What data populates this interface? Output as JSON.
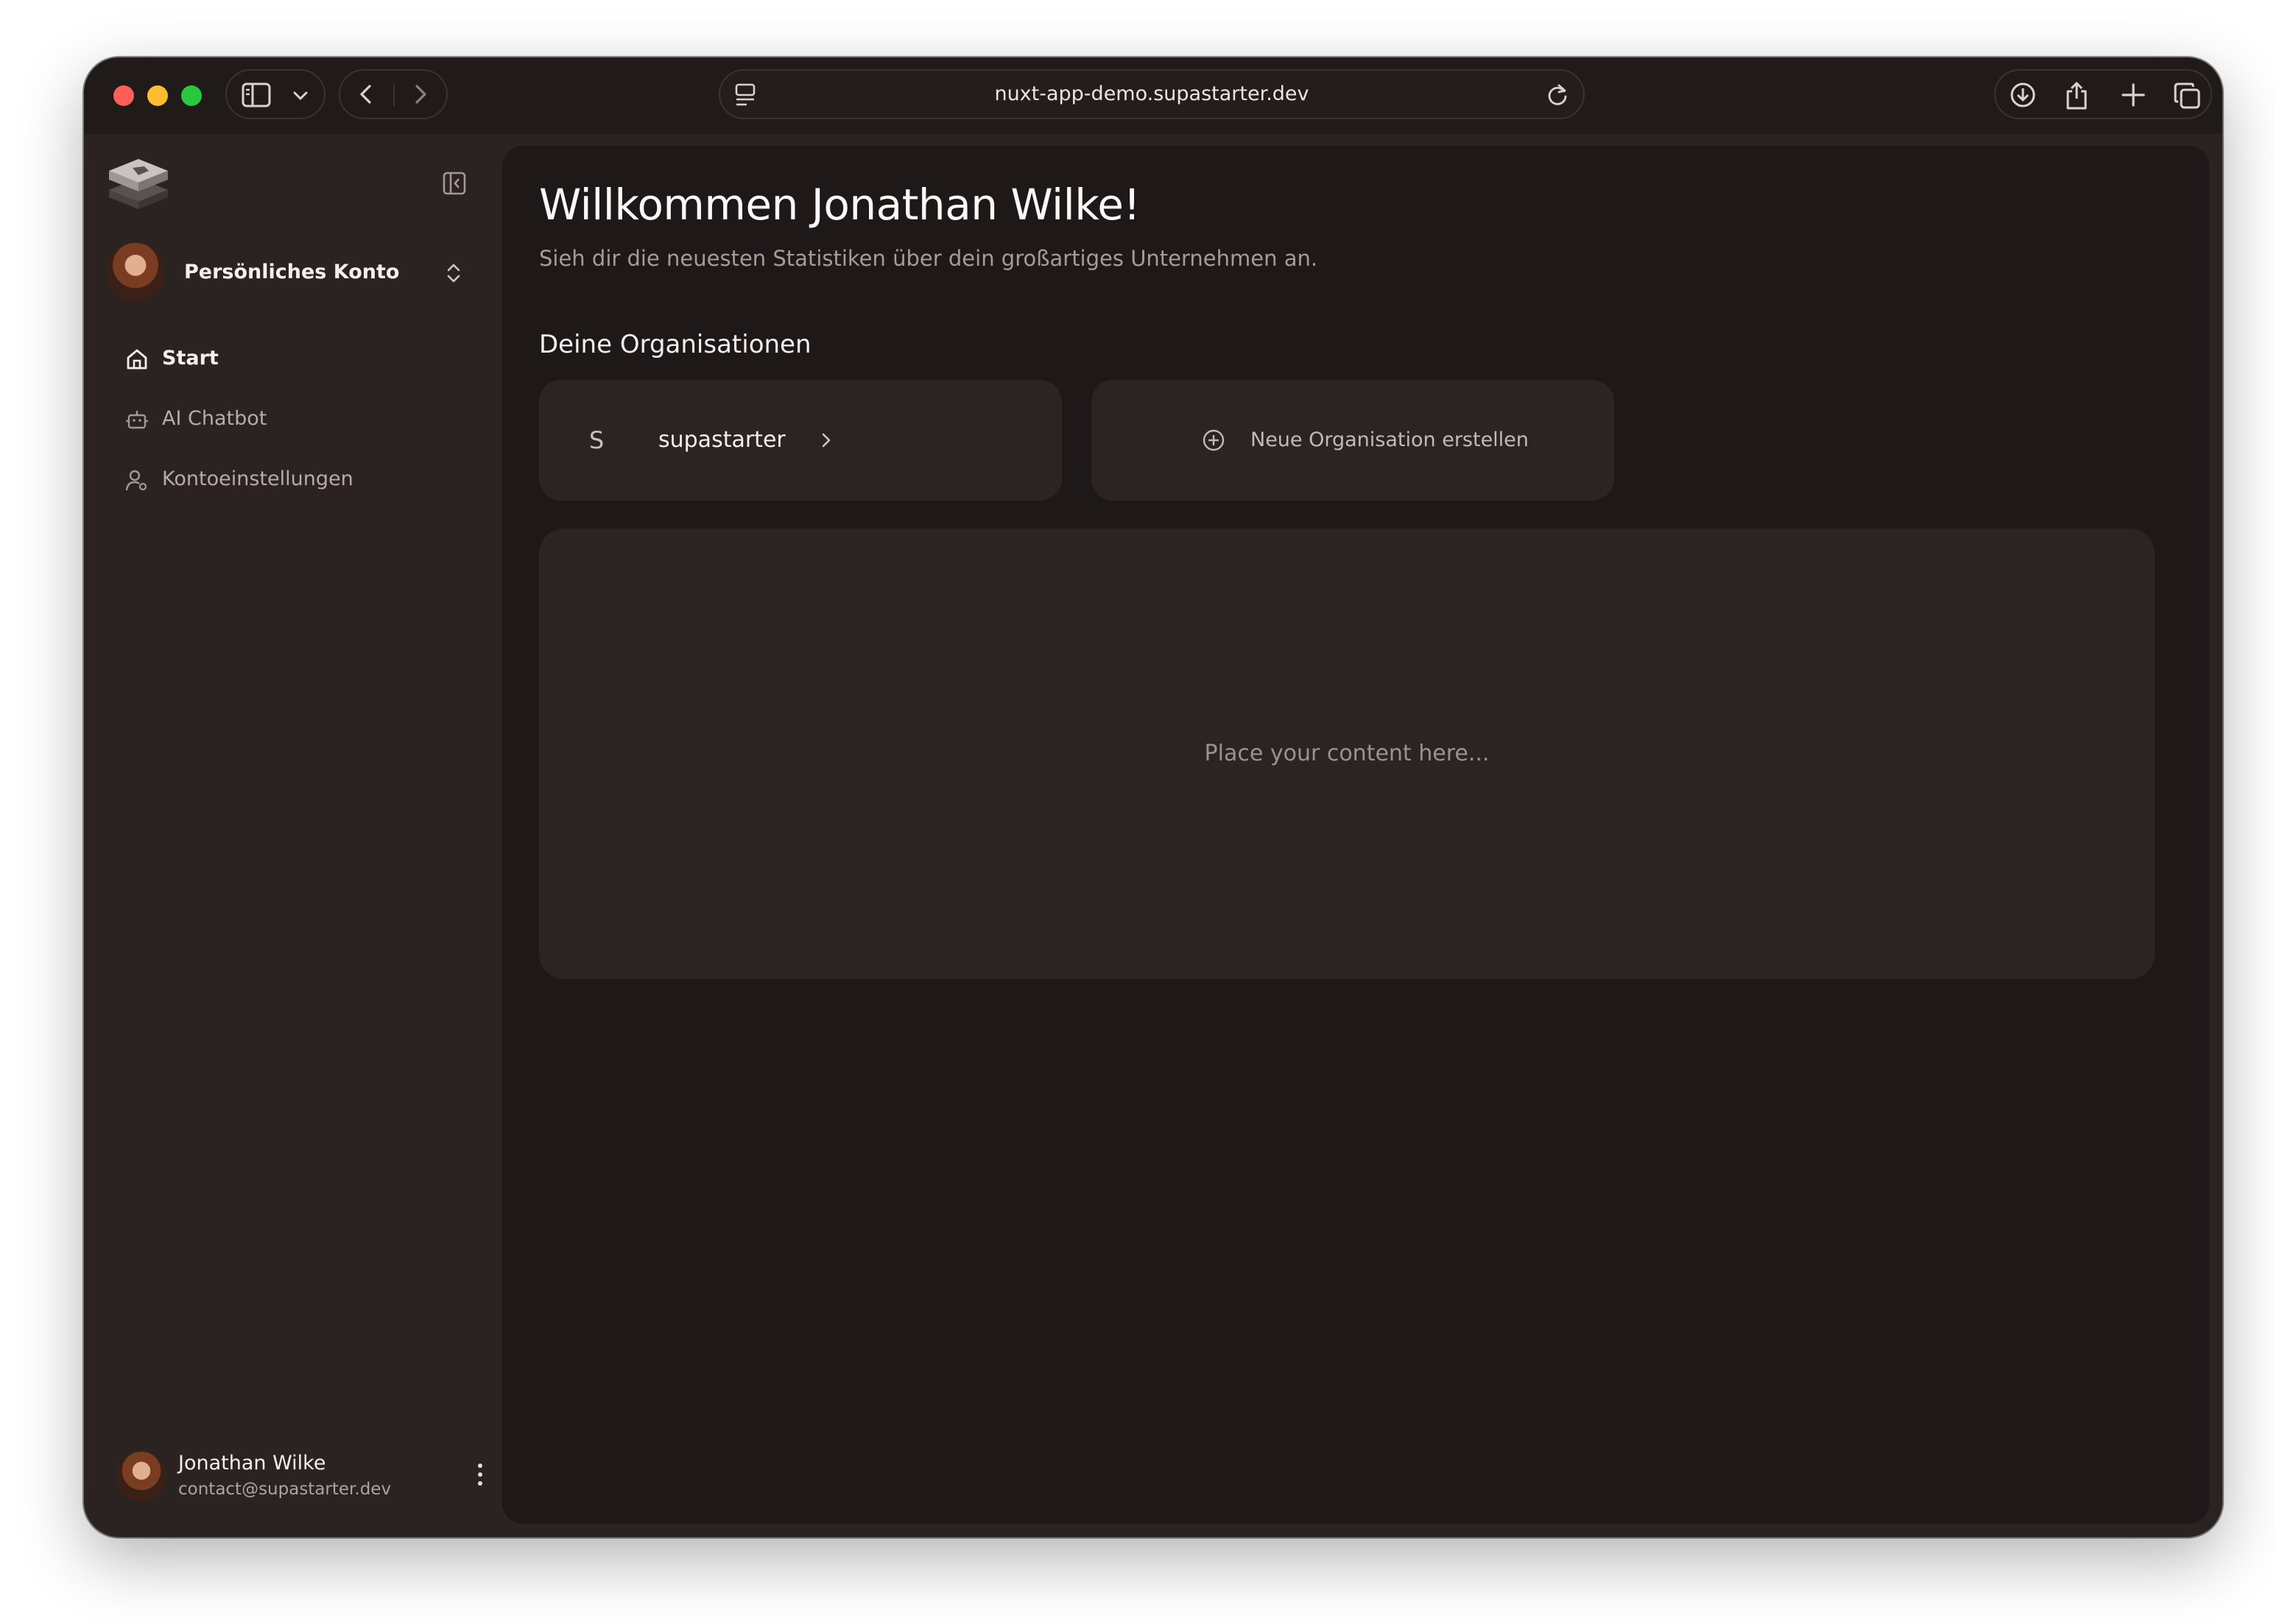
{
  "browser": {
    "url": "nuxt-app-demo.supastarter.dev",
    "icons": [
      "sidebar-toggle-icon",
      "chevron-down-icon",
      "back-icon",
      "forward-icon",
      "page-menu-icon",
      "reload-icon",
      "download-icon",
      "share-icon",
      "plus-icon",
      "tabs-icon"
    ]
  },
  "sidebar": {
    "account": {
      "name": "Persönliches Konto"
    },
    "nav": [
      {
        "label": "Start",
        "icon": "home-icon",
        "active": true
      },
      {
        "label": "AI Chatbot",
        "icon": "bot-icon",
        "active": false
      },
      {
        "label": "Kontoeinstellungen",
        "icon": "user-settings-icon",
        "active": false
      }
    ],
    "user": {
      "name": "Jonathan Wilke",
      "email": "contact@supastarter.dev"
    }
  },
  "main": {
    "title": "Willkommen Jonathan Wilke!",
    "subtitle": "Sieh dir die neuesten Statistiken über dein großartiges Unternehmen an.",
    "orgs_heading": "Deine Organisationen",
    "org": {
      "initial": "S",
      "name": "supastarter"
    },
    "create_org_label": "Neue Organisation erstellen",
    "placeholder": "Place your content here..."
  },
  "colors": {
    "sidebar_bg": "#2a2322",
    "main_bg": "#1e1918",
    "card_bg": "#2b2422",
    "text_primary": "#f3efed",
    "text_muted": "#a69b97"
  }
}
